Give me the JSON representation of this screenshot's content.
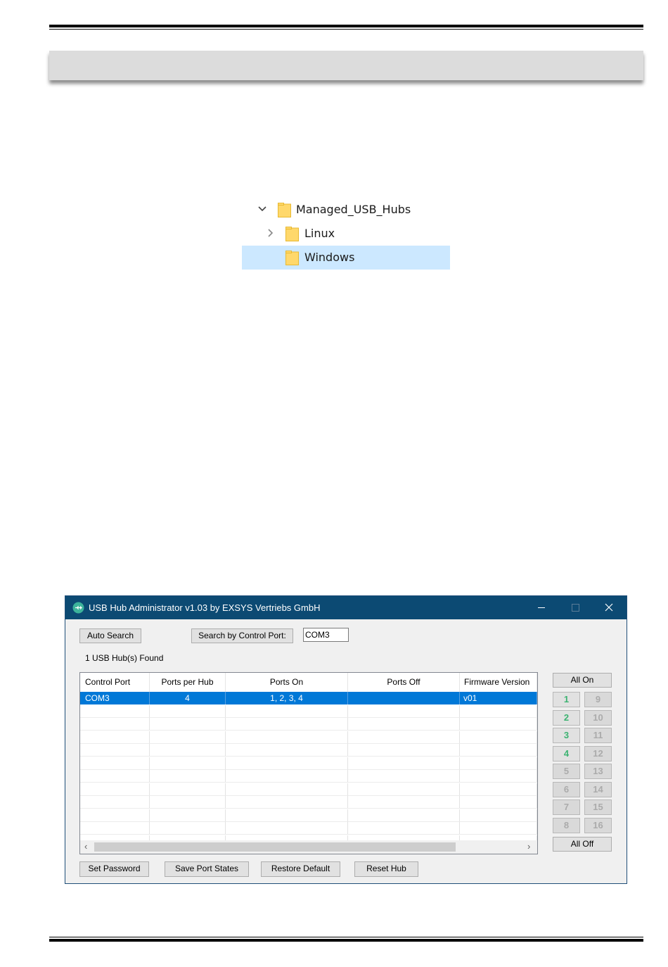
{
  "tree": {
    "items": [
      {
        "label": "Managed_USB_Hubs",
        "expanded": true,
        "selected": false
      },
      {
        "label": "Linux",
        "expanded": false,
        "selected": false
      },
      {
        "label": "Windows",
        "expanded": false,
        "selected": true
      }
    ]
  },
  "app": {
    "title": "USB Hub Administrator v1.03 by EXSYS Vertriebs GmbH",
    "auto_search_label": "Auto Search",
    "search_by_port_label": "Search by Control Port:",
    "control_port_input_value": "COM3",
    "found_text": "1 USB Hub(s) Found",
    "columns": [
      "Control Port",
      "Ports per Hub",
      "Ports On",
      "Ports Off",
      "Firmware Version"
    ],
    "rows": [
      {
        "control_port": "COM3",
        "ports_per_hub": "4",
        "ports_on": "1, 2, 3, 4",
        "ports_off": "",
        "firmware_version": "v01"
      }
    ],
    "all_on_label": "All On",
    "all_off_label": "All Off",
    "ports": [
      {
        "label": "1",
        "state": "on"
      },
      {
        "label": "2",
        "state": "on"
      },
      {
        "label": "3",
        "state": "on"
      },
      {
        "label": "4",
        "state": "on"
      },
      {
        "label": "5",
        "state": "off"
      },
      {
        "label": "6",
        "state": "off"
      },
      {
        "label": "7",
        "state": "off"
      },
      {
        "label": "8",
        "state": "off"
      },
      {
        "label": "9",
        "state": "off"
      },
      {
        "label": "10",
        "state": "off"
      },
      {
        "label": "11",
        "state": "off"
      },
      {
        "label": "12",
        "state": "off"
      },
      {
        "label": "13",
        "state": "off"
      },
      {
        "label": "14",
        "state": "off"
      },
      {
        "label": "15",
        "state": "off"
      },
      {
        "label": "16",
        "state": "off"
      }
    ],
    "bottom_buttons": {
      "set_password": "Set Password",
      "save_port_states": "Save Port States",
      "restore_default": "Restore Default",
      "reset_hub": "Reset Hub"
    }
  },
  "colors": {
    "titlebar": "#0c4a73",
    "selection": "#0078d7",
    "tree_selection": "#cce8ff",
    "port_on": "#3cb371",
    "folder": "#ffd86b"
  }
}
